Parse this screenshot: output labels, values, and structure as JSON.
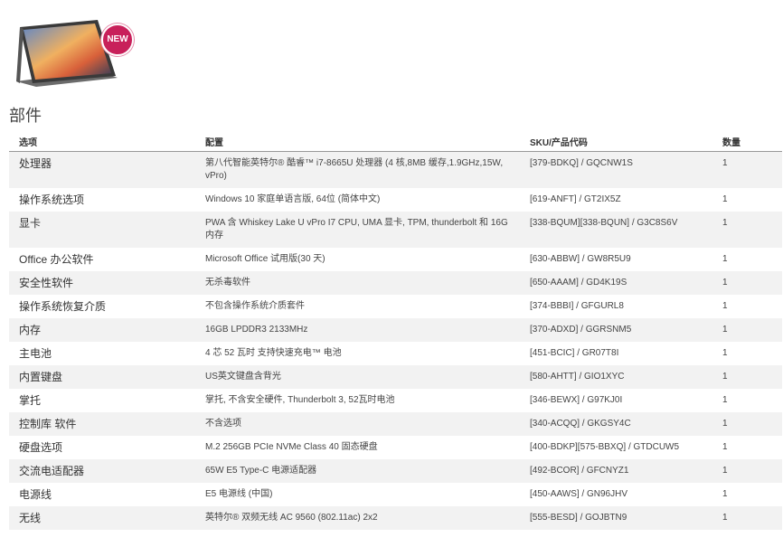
{
  "product": {
    "badge": "NEW",
    "image": "laptop-2in1-image"
  },
  "section_title": "部件",
  "table": {
    "headers": [
      "选项",
      "配置",
      "SKU/产品代码",
      "数量"
    ],
    "rows": [
      {
        "option": "处理器",
        "config": "第八代智能英特尔® 酷睿™ i7-8665U 处理器 (4 核,8MB 缓存,1.9GHz,15W, vPro)",
        "sku": "[379-BDKQ] / GQCNW1S",
        "qty": "1"
      },
      {
        "option": "操作系统选项",
        "config": "Windows 10 家庭单语言版, 64位 (简体中文)",
        "sku": "[619-ANFT] / GT2IX5Z",
        "qty": "1"
      },
      {
        "option": "显卡",
        "config": "PWA 含 Whiskey Lake U vPro I7 CPU, UMA 显卡, TPM, thunderbolt 和 16G 内存",
        "sku": "[338-BQUM][338-BQUN] / G3C8S6V",
        "qty": "1"
      },
      {
        "option": "Office 办公软件",
        "config": "Microsoft Office 试用版(30 天)",
        "sku": "[630-ABBW] / GW8R5U9",
        "qty": "1"
      },
      {
        "option": "安全性软件",
        "config": "无杀毒软件",
        "sku": "[650-AAAM] / GD4K19S",
        "qty": "1"
      },
      {
        "option": "操作系统恢复介质",
        "config": "不包含操作系统介质套件",
        "sku": "[374-BBBI] / GFGURL8",
        "qty": "1"
      },
      {
        "option": "内存",
        "config": "16GB LPDDR3 2133MHz",
        "sku": "[370-ADXD] / GGRSNM5",
        "qty": "1"
      },
      {
        "option": "主电池",
        "config": "4 芯 52 瓦时 支持快速充电™ 电池",
        "sku": "[451-BCIC] / GR07T8I",
        "qty": "1"
      },
      {
        "option": "内置键盘",
        "config": "US英文键盘含背光",
        "sku": "[580-AHTT] / GIO1XYC",
        "qty": "1"
      },
      {
        "option": "掌托",
        "config": "掌托, 不含安全硬件, Thunderbolt 3, 52瓦时电池",
        "sku": "[346-BEWX] / G97KJ0I",
        "qty": "1"
      },
      {
        "option": "控制库 软件",
        "config": "不含选项",
        "sku": "[340-ACQQ] / GKGSY4C",
        "qty": "1"
      },
      {
        "option": "硬盘选项",
        "config": "M.2 256GB PCIe NVMe Class 40 固态硬盘",
        "sku": "[400-BDKP][575-BBXQ] / GTDCUW5",
        "qty": "1"
      },
      {
        "option": "交流电适配器",
        "config": "65W E5 Type-C 电源适配器",
        "sku": "[492-BCOR] / GFCNYZ1",
        "qty": "1"
      },
      {
        "option": "电源线",
        "config": "E5 电源线 (中国)",
        "sku": "[450-AAWS] / GN96JHV",
        "qty": "1"
      },
      {
        "option": "无线",
        "config": "英特尔® 双频无线 AC 9560 (802.11ac) 2x2",
        "sku": "[555-BESD] / GOJBTN9",
        "qty": "1"
      }
    ]
  },
  "colors": {
    "badge": "#c8205a",
    "row_alt": "#f2f2f2",
    "header_rule": "#999999",
    "text": "#444444"
  }
}
